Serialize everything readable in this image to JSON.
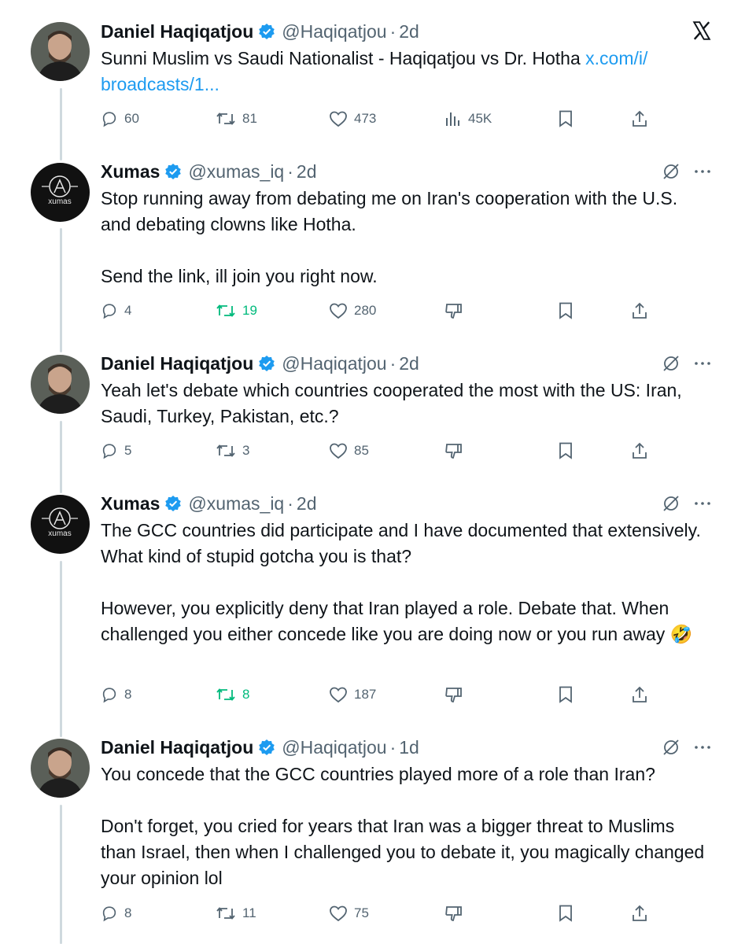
{
  "x_logo": "x-logo-icon",
  "tweets": [
    {
      "name": "Daniel Haqiqatjou",
      "handle": "@Haqiqatjou",
      "time": "2d",
      "text": "Sunni Muslim vs Saudi Nationalist - Haqiqatjou vs Dr. Hotha ",
      "link": "x.com/i/ broadcasts/1...",
      "replies": "60",
      "reposts": "81",
      "likes": "473",
      "views": "45K"
    },
    {
      "name": "Xumas",
      "handle": "@xumas_iq",
      "time": "2d",
      "text": "Stop running away from debating me on Iran's cooperation with the U.S. and debating clowns like Hotha.\n\nSend the link, ill join you right now.",
      "replies": "4",
      "reposts": "19",
      "likes": "280"
    },
    {
      "name": "Daniel Haqiqatjou",
      "handle": "@Haqiqatjou",
      "time": "2d",
      "text": "Yeah let's debate which countries cooperated the most with the US: Iran, Saudi, Turkey, Pakistan, etc.?",
      "replies": "5",
      "reposts": "3",
      "likes": "85"
    },
    {
      "name": "Xumas",
      "handle": "@xumas_iq",
      "time": "2d",
      "text": "The GCC countries did participate and I have documented that extensively. What kind of stupid gotcha you is that?\n\nHowever, you explicitly deny that Iran played a role. Debate that. When challenged you either concede like you are doing now or you run away 🤣",
      "replies": "8",
      "reposts": "8",
      "likes": "187"
    },
    {
      "name": "Daniel Haqiqatjou",
      "handle": "@Haqiqatjou",
      "time": "1d",
      "text": "You concede that the GCC countries played more of a role than Iran?\n\nDon't forget, you cried for years that Iran was a bigger threat to Muslims than Israel, then when I challenged you to debate it, you magically changed your opinion lol",
      "replies": "8",
      "reposts": "11",
      "likes": "75"
    }
  ],
  "avatar_text": "xumas",
  "colors": {
    "verified": "#1d9bf0",
    "link": "#1d9bf0",
    "repost_active": "#00ba7c",
    "muted": "#536471"
  }
}
